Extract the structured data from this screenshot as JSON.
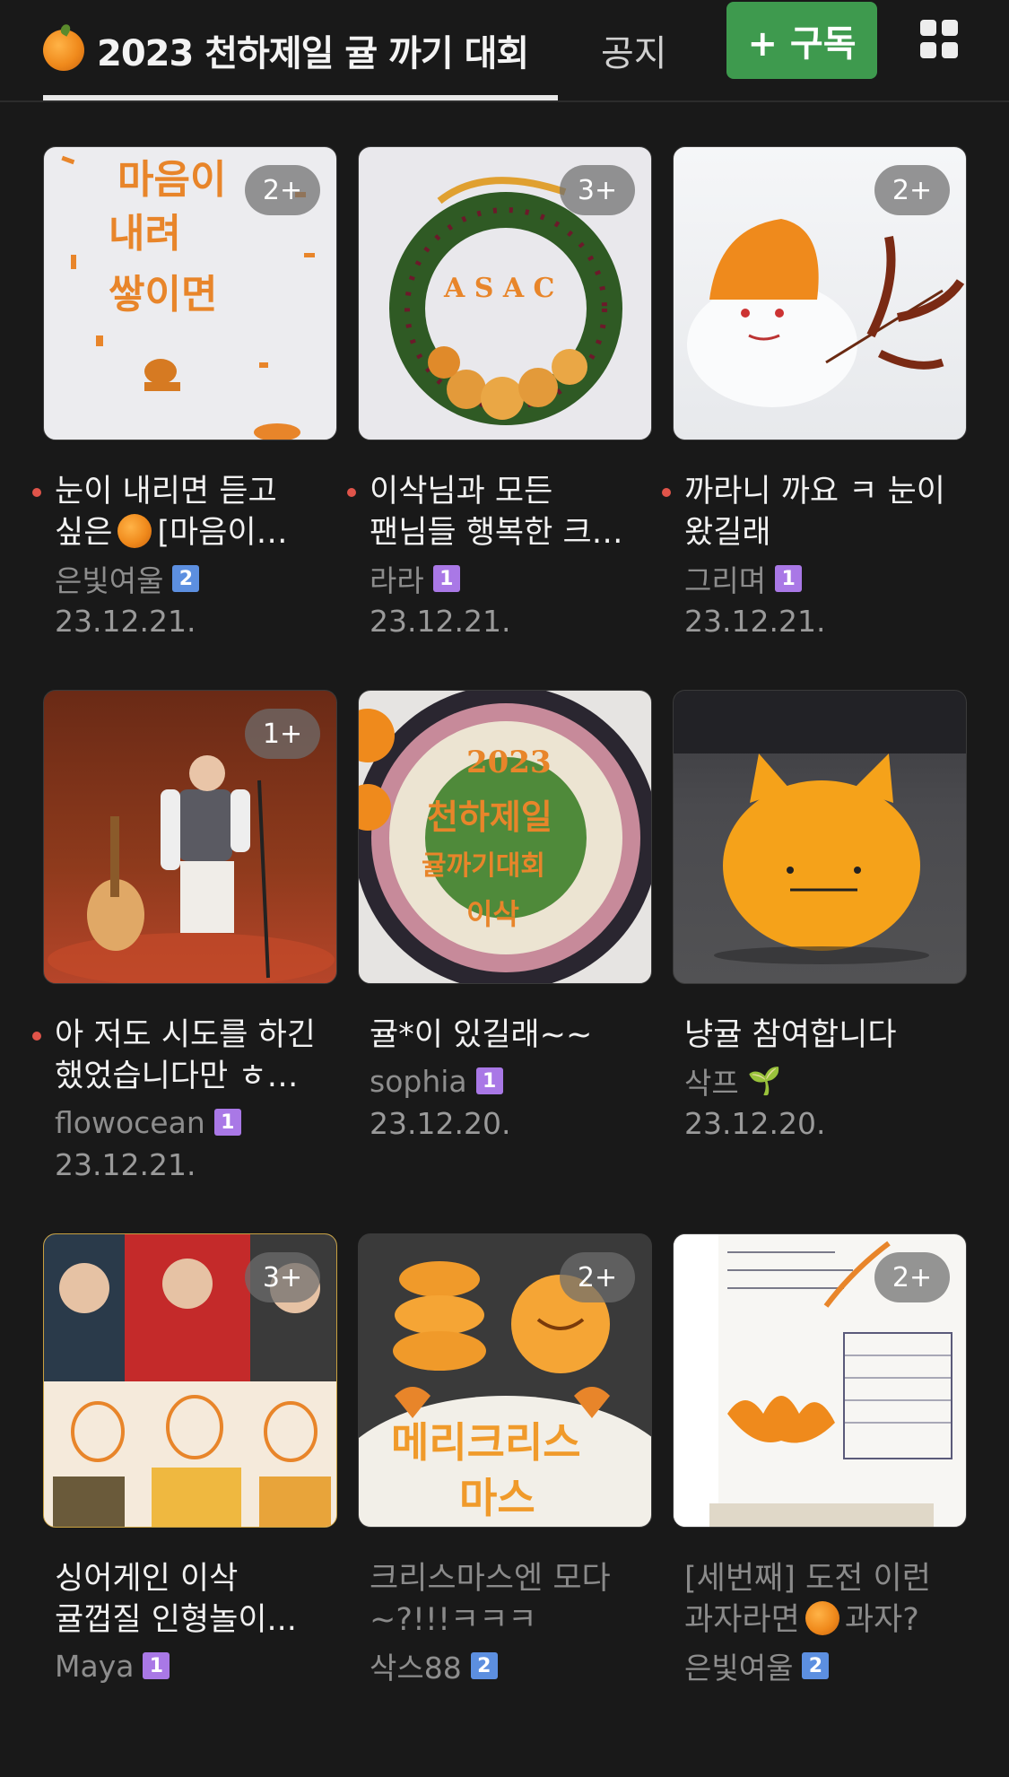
{
  "header": {
    "title": "2023 천하제일 귤 까기 대회",
    "notice_tab": "공지",
    "subscribe_label": "+ 구독"
  },
  "posts": [
    {
      "title": "눈이 내리면 듣고 싶은",
      "title_tail": "[마음이…",
      "author": "은빛여울",
      "level": "2",
      "date": "23.12.21.",
      "badge": "2+",
      "new": true
    },
    {
      "title": "이삭님과 모든 팬님들 행복한 크…",
      "author": "라라",
      "level": "1",
      "date": "23.12.21.",
      "badge": "3+",
      "new": true
    },
    {
      "title": "까라니 까요 ㅋ 눈이 왔길래",
      "author": "그리며",
      "level": "1",
      "date": "23.12.21.",
      "badge": "2+",
      "new": true
    },
    {
      "title": "아 저도 시도를 하긴 했었습니다만 ㅎ…",
      "author": "flowocean",
      "level": "1",
      "date": "23.12.21.",
      "badge": "1+",
      "new": true
    },
    {
      "title": "귤*이 있길래~~",
      "author": "sophia",
      "level": "1",
      "date": "23.12.20.",
      "badge": "",
      "new": false
    },
    {
      "title": "냥귤 참여합니다",
      "author": "삭프",
      "level": "sprout",
      "date": "23.12.20.",
      "badge": "",
      "new": false
    },
    {
      "title": "싱어게인 이삭 귤껍질 인형놀이...",
      "author": "Maya",
      "level": "1",
      "date": "",
      "badge": "3+",
      "new": false
    },
    {
      "title": "크리스마스엔 모다 ~?!!!ㅋㅋㅋ",
      "author": "삭스88",
      "level": "2",
      "date": "",
      "badge": "2+",
      "new": false,
      "dim": true
    },
    {
      "title": "[세번째] 도전 이런 과자라면",
      "title_tail": "과자?",
      "author": "은빛여울",
      "level": "2",
      "date": "",
      "badge": "2+",
      "new": false,
      "dim": true
    }
  ],
  "thumb_text": {
    "t1": [
      "마음이",
      "내려",
      "쌓이면"
    ],
    "t2": "A  S  A  C",
    "t5": [
      "2023",
      "천하제일",
      "귤까기대회",
      "이삭"
    ],
    "t8": [
      "메리크리스",
      "마스"
    ]
  },
  "colors": {
    "accent_green": "#3e9a4e",
    "peel_orange": "#e8852a",
    "new_dot": "#e0544a"
  }
}
